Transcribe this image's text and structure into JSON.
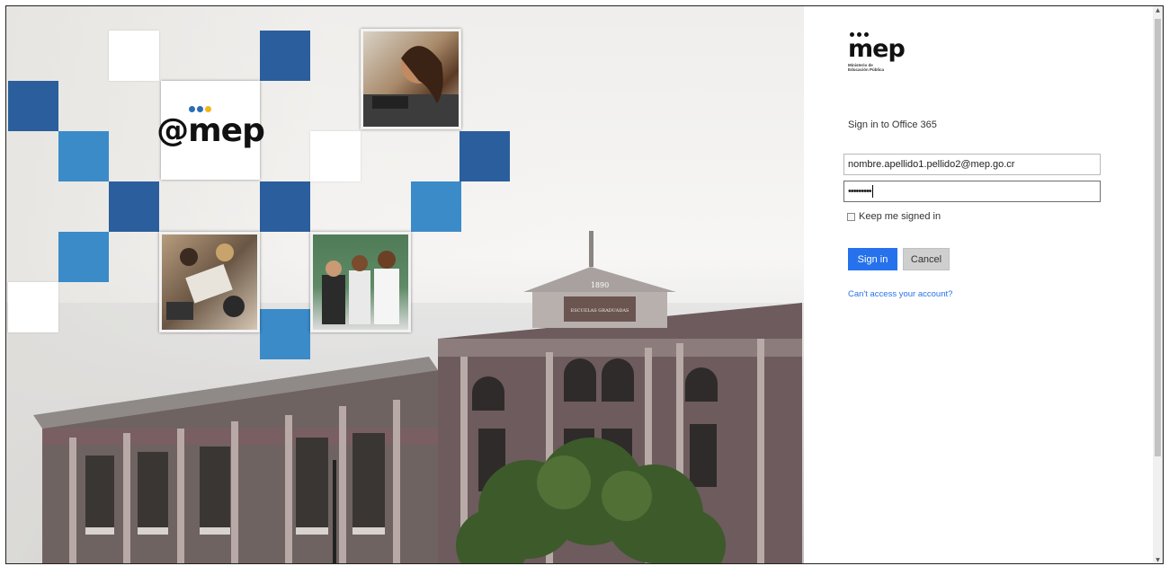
{
  "hero": {
    "logo_text": "@mep",
    "building_sign_year": "1890",
    "building_sign_text": "ESCUELAS GRADUADAS",
    "colors": {
      "tile_dark": "#2b5e9c",
      "tile_mid": "#3a8bc8",
      "logo_dot_blue": "#2a6db8",
      "logo_dot_yellow": "#f2b51c"
    }
  },
  "panel": {
    "brand_name": "mep",
    "brand_subtitle_line1": "Ministerio de",
    "brand_subtitle_line2": "Educación Pública",
    "title": "Sign in to Office 365",
    "username_value": "nombre.apellido1.pellido2@mep.go.cr",
    "password_mask": "•••••••••",
    "keep_signed_in_label": "Keep me signed in",
    "keep_signed_in_checked": false,
    "sign_in_button": "Sign in",
    "cancel_button": "Cancel",
    "cant_access_link": "Can't access your account?",
    "colors": {
      "accent": "#2672ec",
      "cancel_bg": "#cfcfcf"
    }
  },
  "scrollbar": {
    "up_icon": "chevron-up-icon",
    "down_icon": "chevron-down-icon"
  }
}
